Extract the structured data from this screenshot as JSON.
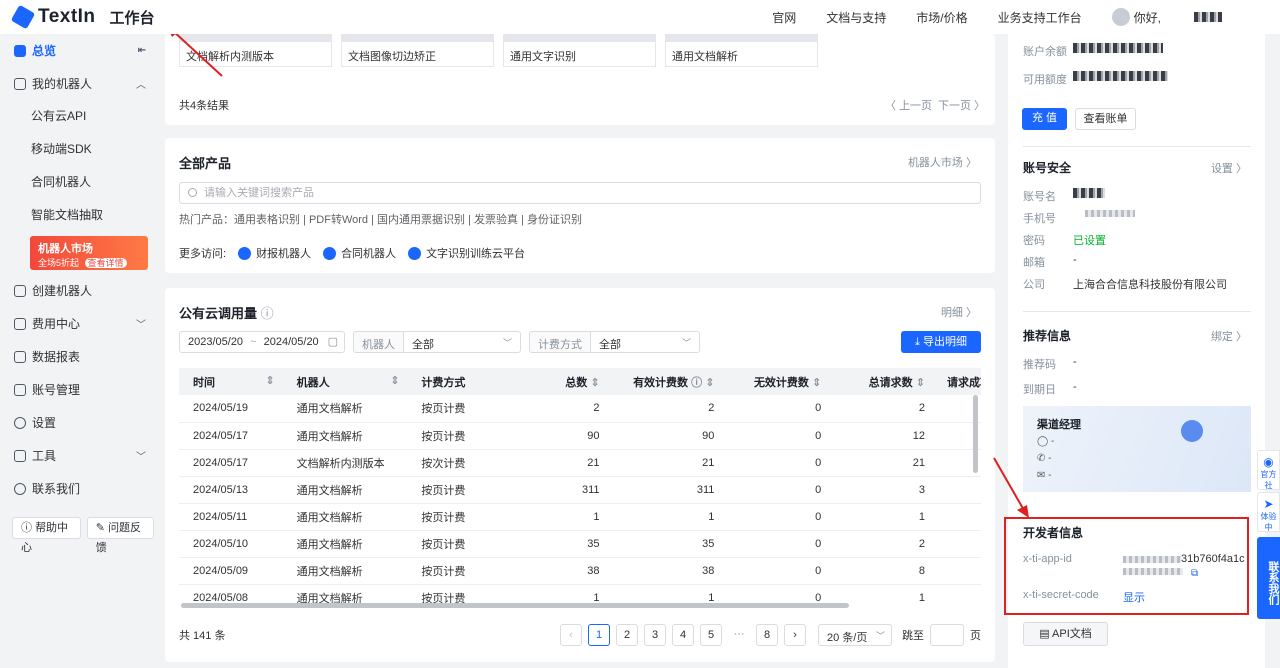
{
  "header": {
    "brand": "TextIn",
    "workspace": "工作台",
    "nav": [
      "官网",
      "文档与支持",
      "市场/价格",
      "业务支持工作台"
    ],
    "greeting": "你好,"
  },
  "sidebar": {
    "overview": "总览",
    "my_robots": "我的机器人",
    "sub_items": [
      "公有云API",
      "移动端SDK",
      "合同机器人",
      "智能文档抽取"
    ],
    "promo_title": "机器人市场",
    "promo_sub": "全场5折起",
    "promo_cta": "查看详情",
    "items": [
      "创建机器人",
      "费用中心",
      "数据报表",
      "账号管理",
      "设置",
      "工具",
      "联系我们"
    ],
    "help": "帮助中心",
    "feedback": "问题反馈"
  },
  "recent": {
    "chips": [
      "文档解析内测版本",
      "文档图像切边矫正",
      "通用文字识别",
      "通用文档解析"
    ],
    "result_count": "共4条结果",
    "prev": "上一页",
    "next": "下一页"
  },
  "products": {
    "title": "全部产品",
    "market_link": "机器人市场",
    "search_placeholder": "请输入关键词搜索产品",
    "hot": "热门产品：通用表格识别 | PDF转Word | 国内通用票据识别 | 发票验真 | 身份证识别",
    "more_label": "更多访问:",
    "more_links": [
      "财报机器人",
      "合同机器人",
      "文字识别训练云平台"
    ]
  },
  "usage": {
    "title": "公有云调用量",
    "detail_link": "明细",
    "date_from": "2023/05/20",
    "date_to": "2024/05/20",
    "robot_label": "机器人",
    "robot_value": "全部",
    "billing_label": "计费方式",
    "billing_value": "全部",
    "export": "导出明细",
    "columns": [
      "时间",
      "机器人",
      "计费方式",
      "总数",
      "有效计费数",
      "无效计费数",
      "总请求数",
      "请求成功"
    ],
    "rows": [
      [
        "2024/05/19",
        "通用文档解析",
        "按页计费",
        "2",
        "2",
        "0",
        "2"
      ],
      [
        "2024/05/17",
        "通用文档解析",
        "按页计费",
        "90",
        "90",
        "0",
        "12"
      ],
      [
        "2024/05/17",
        "文档解析内测版本",
        "按次计费",
        "21",
        "21",
        "0",
        "21"
      ],
      [
        "2024/05/13",
        "通用文档解析",
        "按页计费",
        "311",
        "311",
        "0",
        "3"
      ],
      [
        "2024/05/11",
        "通用文档解析",
        "按页计费",
        "1",
        "1",
        "0",
        "1"
      ],
      [
        "2024/05/10",
        "通用文档解析",
        "按页计费",
        "35",
        "35",
        "0",
        "2"
      ],
      [
        "2024/05/09",
        "通用文档解析",
        "按页计费",
        "38",
        "38",
        "0",
        "8"
      ],
      [
        "2024/05/08",
        "通用文档解析",
        "按页计费",
        "1",
        "1",
        "0",
        "1"
      ]
    ],
    "total": "共 141 条",
    "pages": [
      "1",
      "2",
      "3",
      "4",
      "5",
      "···",
      "8"
    ],
    "current_page": "1",
    "page_size": "20 条/页",
    "goto": "跳至",
    "page_unit": "页"
  },
  "account": {
    "balance_label": "账户余额",
    "credit_label": "可用额度",
    "recharge": "充 值",
    "bill": "查看账单",
    "security_title": "账号安全",
    "settings": "设置",
    "name_label": "账号名",
    "phone_label": "手机号",
    "password_label": "密码",
    "password_value": "已设置",
    "email_label": "邮箱",
    "email_value": "-",
    "company_label": "公司",
    "company_value": "上海合合信息科技股份有限公司",
    "recommend_title": "推荐信息",
    "bind": "绑定",
    "code_label": "推荐码",
    "code_value": "-",
    "expire_label": "到期日",
    "expire_value": "-",
    "manager_title": "渠道经理",
    "manager_lines": [
      "-",
      "-",
      "-"
    ],
    "dev_title": "开发者信息",
    "app_id_label": "x-ti-app-id",
    "app_id_visible": "31b760f4a1c",
    "secret_label": "x-ti-secret-code",
    "secret_show": "显示",
    "api_doc": "API文档"
  },
  "float": {
    "items": [
      "官方社",
      "体验中"
    ],
    "contact": "联系我们"
  }
}
